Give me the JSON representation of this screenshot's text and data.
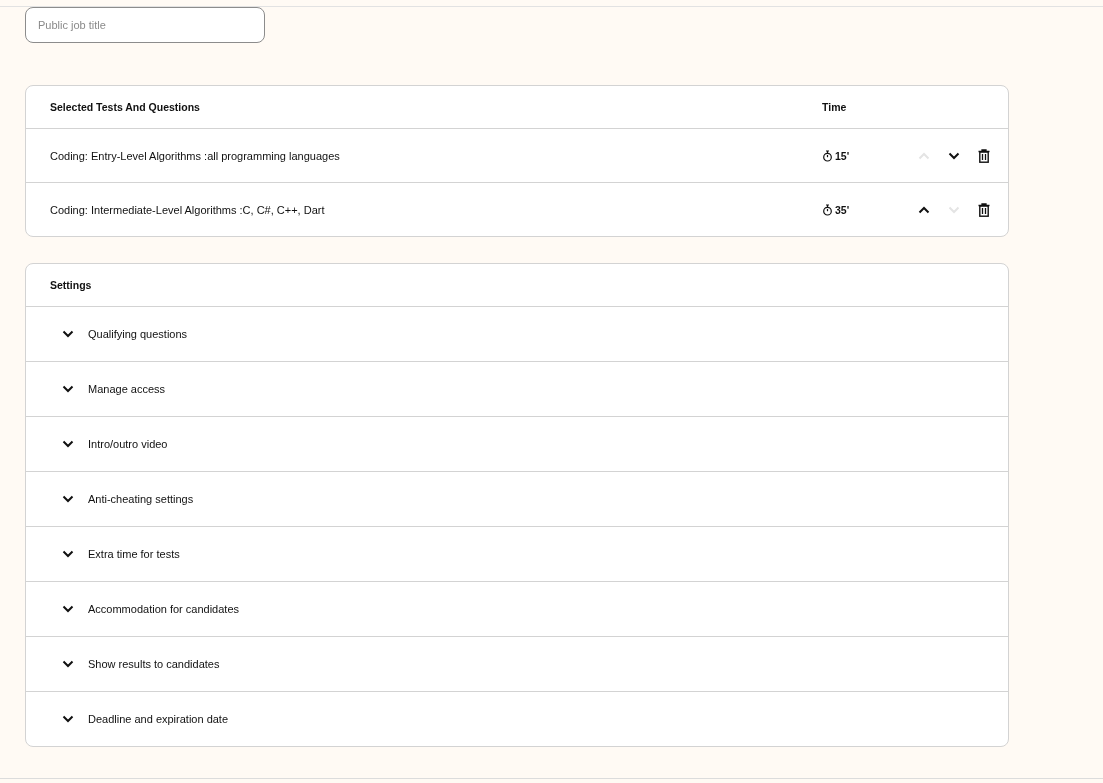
{
  "job_title_field": {
    "placeholder": "Public job title"
  },
  "tests": {
    "columns": [
      "Selected Tests And Questions",
      "Time"
    ],
    "rows": [
      {
        "name": "Coding: Entry-Level Algorithms :all programming languages",
        "time": "15'",
        "move_up_disabled": true,
        "move_down_disabled": false
      },
      {
        "name": "Coding: Intermediate-Level Algorithms :C, C#, C++, Dart",
        "time": "35'",
        "move_up_disabled": false,
        "move_down_disabled": true
      }
    ]
  },
  "settings": {
    "title": "Settings",
    "items": [
      {
        "label": "Qualifying questions",
        "expanded": false
      },
      {
        "label": "Manage access",
        "expanded": false
      },
      {
        "label": "Intro/outro video",
        "expanded": false
      },
      {
        "label": "Anti-cheating settings",
        "expanded": false
      },
      {
        "label": "Extra time for tests",
        "expanded": false
      },
      {
        "label": "Accommodation for candidates",
        "expanded": false
      },
      {
        "label": "Show results to candidates",
        "expanded": false
      },
      {
        "label": "Deadline and expiration date",
        "expanded": false
      }
    ]
  }
}
